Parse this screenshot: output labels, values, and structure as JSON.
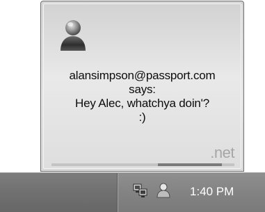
{
  "notification": {
    "sender": "alansimpson@passport.com",
    "says_label": "says:",
    "message_line1": "Hey Alec, whatchya doin'?",
    "message_line2": ":)",
    "brand": ".net",
    "buddy_icon": "messenger-buddy-icon",
    "progress_fraction": 0.35
  },
  "taskbar": {
    "tray_icons": [
      "network-connection-icon",
      "messenger-tray-icon"
    ],
    "clock": "1:40 PM"
  }
}
